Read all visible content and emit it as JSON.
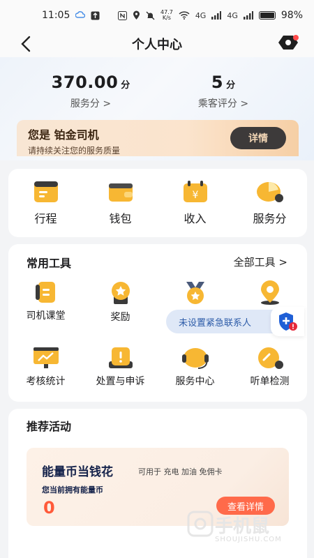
{
  "status_bar": {
    "time": "11:05",
    "net_speed_value": "47.7",
    "net_speed_unit": "K/s",
    "battery": "98%",
    "signal_1": "4G",
    "signal_2": "4G"
  },
  "header": {
    "title": "个人中心"
  },
  "scores": {
    "service_value": "370.00",
    "service_unit": "分",
    "service_label": "服务分 >",
    "rating_value": "5",
    "rating_unit": "分",
    "rating_label": "乘客评分 >"
  },
  "tier": {
    "title": "您是 铂金司机",
    "subtitle": "请持续关注您的服务质量",
    "detail_button": "详情"
  },
  "quick_actions": [
    {
      "label": "行程",
      "icon": "trip-icon"
    },
    {
      "label": "钱包",
      "icon": "wallet-icon"
    },
    {
      "label": "收入",
      "icon": "income-icon"
    },
    {
      "label": "服务分",
      "icon": "service-score-icon"
    }
  ],
  "tools": {
    "title": "常用工具",
    "all_link": "全部工具 >",
    "items": [
      {
        "label": "司机课堂",
        "icon": "driver-class-icon"
      },
      {
        "label": "奖励",
        "icon": "reward-icon"
      },
      {
        "label": "",
        "icon": "medal-icon"
      },
      {
        "label": "",
        "icon": "location-icon"
      },
      {
        "label": "考核统计",
        "icon": "assessment-icon"
      },
      {
        "label": "处置与申诉",
        "icon": "appeal-icon"
      },
      {
        "label": "服务中心",
        "icon": "service-center-icon"
      },
      {
        "label": "听单检测",
        "icon": "order-check-icon"
      }
    ]
  },
  "toast": {
    "text": "未设置紧急联系人"
  },
  "promo": {
    "section_title": "推荐活动",
    "name": "能量币当钱花",
    "tags": "可用于 充电 加油 免佣卡",
    "desc": "您当前拥有能量币",
    "value": "0",
    "button": "查看详情"
  },
  "watermark": {
    "text": "手机鼠",
    "sub": "SHOUJISHU.COM"
  },
  "colors": {
    "accent_orange": "#ff6a4a",
    "gold": "#f7b733",
    "dark_button": "#3d3a3a"
  }
}
